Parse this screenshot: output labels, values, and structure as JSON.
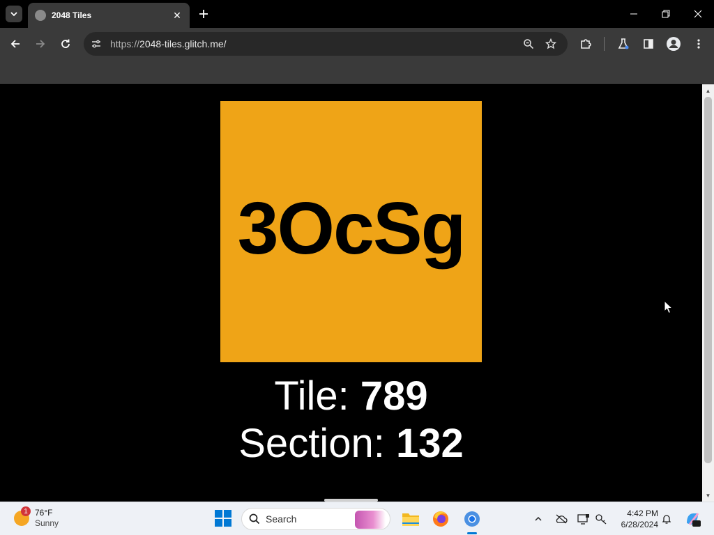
{
  "browser": {
    "tab_title": "2048 Tiles",
    "url_scheme": "https://",
    "url_host": "2048-tiles.glitch.me/"
  },
  "page": {
    "tile_text": "3OcSg",
    "tile_color": "#efa417",
    "tile_label": "Tile:",
    "tile_number": "789",
    "section_label": "Section:",
    "section_number": "132"
  },
  "taskbar": {
    "weather_badge": "1",
    "temperature": "76°F",
    "condition": "Sunny",
    "search_placeholder": "Search",
    "time": "4:42 PM",
    "date": "6/28/2024"
  },
  "icons": {
    "back": "arrow-left-icon",
    "forward": "arrow-right-icon",
    "reload": "reload-icon",
    "zoom": "zoom-icon",
    "bookmark": "star-icon",
    "extensions": "puzzle-icon",
    "labs": "flask-icon",
    "side_panel": "side-panel-icon",
    "profile": "profile-icon",
    "menu": "kebab-menu-icon"
  }
}
